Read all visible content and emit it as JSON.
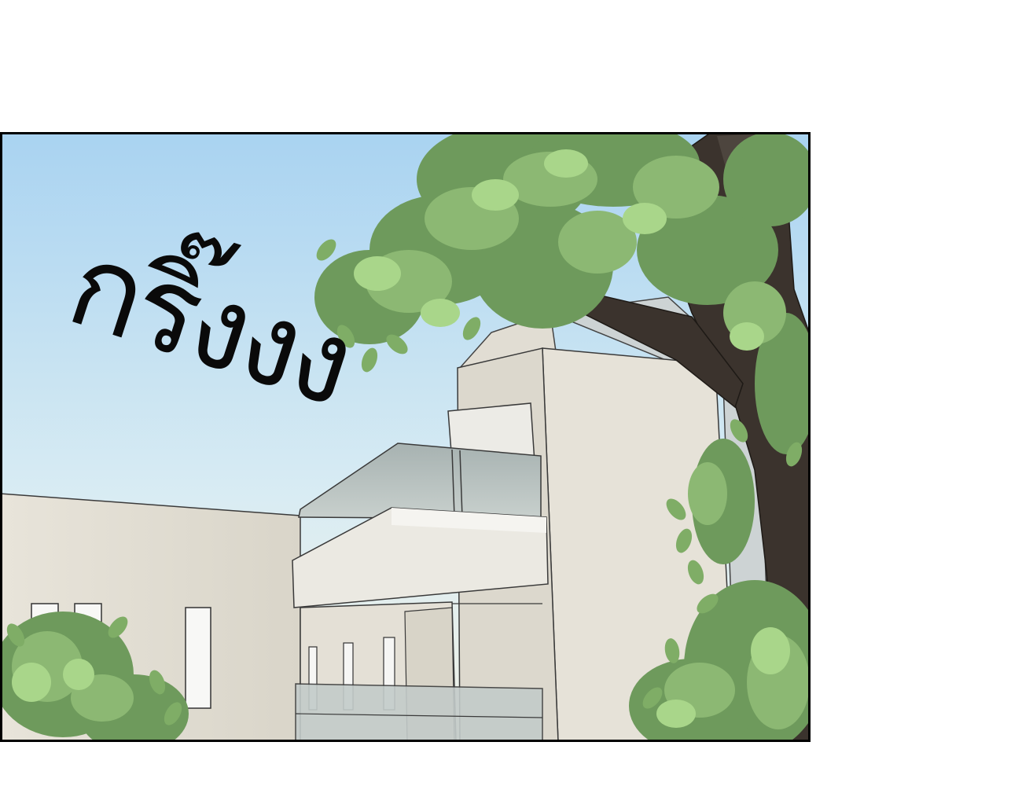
{
  "panel": {
    "sfx_text": "กริ๊งงง",
    "colors": {
      "sky_top": "#aad4f2",
      "sky_bottom": "#eef3ea",
      "building": "#e6e2d8",
      "building_shadow": "#d6d2c6",
      "glass": "#b7c1c0",
      "leaf_dark": "#6e9a5c",
      "leaf_mid": "#8cb873",
      "leaf_light": "#a9d68a",
      "trunk": "#3b332d",
      "border": "#000000"
    }
  }
}
